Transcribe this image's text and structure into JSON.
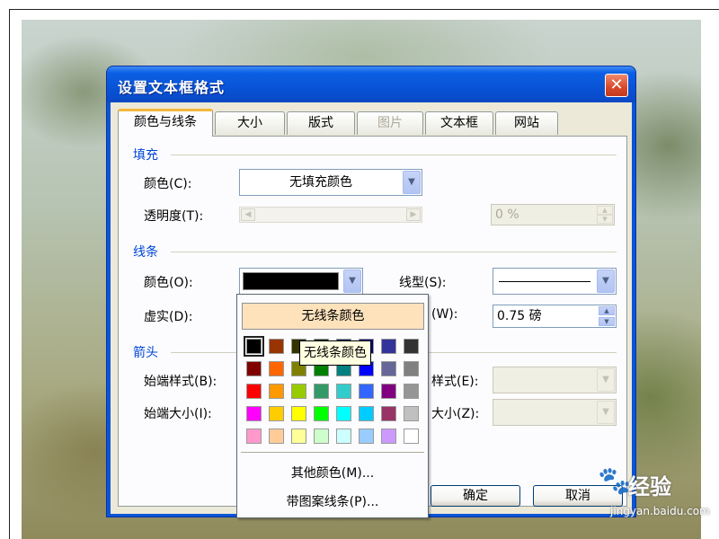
{
  "dialog": {
    "title": "设置文本框格式",
    "close_label": "✕",
    "tabs": [
      {
        "label": "颜色与线条",
        "active": true
      },
      {
        "label": "大小"
      },
      {
        "label": "版式"
      },
      {
        "label": "图片",
        "disabled": true
      },
      {
        "label": "文本框"
      },
      {
        "label": "网站"
      }
    ],
    "fill": {
      "section": "填充",
      "color_label": "颜色(C):",
      "color_value": "无填充颜色",
      "transparency_label": "透明度(T):",
      "transparency_value": "0 %"
    },
    "line": {
      "section": "线条",
      "color_label": "颜色(O):",
      "color_value": "#000000",
      "dash_label": "虚实(D):",
      "style_label": "线型(S):",
      "weight_label": "(W):",
      "weight_value": "0.75 磅"
    },
    "arrows": {
      "section": "箭头",
      "begin_style_label": "始端样式(B):",
      "begin_size_label": "始端大小(I):",
      "end_style_label": "样式(E):",
      "end_size_label": "大小(Z):"
    },
    "ok_label": "确定",
    "cancel_label": "取消"
  },
  "color_popup": {
    "no_line": "无线条颜色",
    "tooltip": "无线条颜色",
    "more_colors": "其他颜色(M)...",
    "patterned": "带图案线条(P)...",
    "swatches": [
      [
        "#000000",
        "#993300",
        "#333300",
        "#003300",
        "#003366",
        "#000080",
        "#333399",
        "#333333"
      ],
      [
        "#800000",
        "#FF6600",
        "#808000",
        "#008000",
        "#008080",
        "#0000FF",
        "#666699",
        "#808080"
      ],
      [
        "#FF0000",
        "#FF9900",
        "#99CC00",
        "#339966",
        "#33CCCC",
        "#3366FF",
        "#800080",
        "#969696"
      ],
      [
        "#FF00FF",
        "#FFCC00",
        "#FFFF00",
        "#00FF00",
        "#00FFFF",
        "#00CCFF",
        "#993366",
        "#C0C0C0"
      ],
      [
        "#FF99CC",
        "#FFCC99",
        "#FFFF99",
        "#CCFFCC",
        "#CCFFFF",
        "#99CCFF",
        "#CC99FF",
        "#FFFFFF"
      ]
    ]
  },
  "watermark": {
    "brand": "经验",
    "url": "jingyan.baidu.com"
  }
}
